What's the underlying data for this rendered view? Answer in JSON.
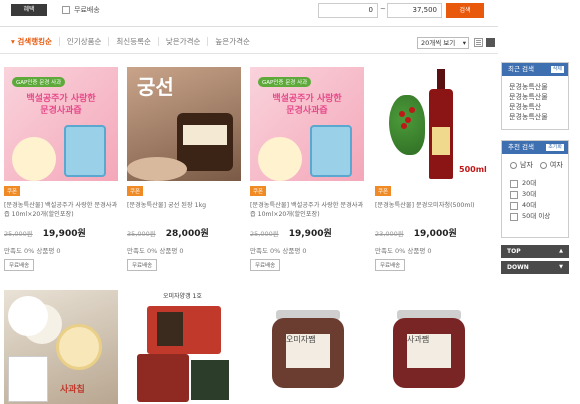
{
  "filter": {
    "benefit_label": "혜택",
    "free_shipping_label": "무료배송",
    "price_min": "0",
    "price_max": "37,500",
    "search_label": "검색"
  },
  "sort": {
    "items": [
      "검색랭킹순",
      "인기상품순",
      "최신등록순",
      "낮은가격순",
      "높은가격순"
    ],
    "active": "검색랭킹순",
    "per_page": "20개씩 보기"
  },
  "products": [
    {
      "badge": "GAP인증 문경 사과",
      "img_text": "백설공주가 사랑한\n문경사과즙",
      "tag": "쿠폰",
      "name": "[문경농특산물] 백설공주가 사랑한 문경사과즙 10ml×20개(할인포장)",
      "old_price": "25,000원",
      "price": "19,900원",
      "satisfaction": "만족도 0%",
      "reviews": "상품평 0",
      "ship": "무료배송"
    },
    {
      "img_text": "궁선",
      "tag": "쿠폰",
      "name": "[문경농특산물] 궁선 된장 1kg",
      "old_price": "35,000원",
      "price": "28,000원",
      "satisfaction": "만족도 0%",
      "reviews": "상품평 0",
      "ship": "무료배송"
    },
    {
      "badge": "GAP인증 문경 사과",
      "img_text": "백설공주가 사랑한\n문경사과즙",
      "tag": "쿠폰",
      "name": "[문경농특산물] 백설공주가 사랑한 문경사과즙 10ml×20개(할인포장)",
      "old_price": "25,000원",
      "price": "19,900원",
      "satisfaction": "만족도 0%",
      "reviews": "상품평 0",
      "ship": "무료배송"
    },
    {
      "img_text": "500ml",
      "tag": "쿠폰",
      "name": "[문경농특산물] 문경오미자청(500ml)",
      "old_price": "23,000원",
      "price": "19,000원",
      "satisfaction": "만족도 0%",
      "reviews": "상품평 0",
      "ship": "무료배송"
    }
  ],
  "row2": [
    {
      "img_text": "사과칩"
    },
    {
      "img_text": "오미자양갱 1호"
    },
    {
      "img_text": "오미자쨈"
    },
    {
      "img_text": "사과쨈"
    }
  ],
  "sidebar": {
    "recent_title": "최근 검색",
    "recent_mini": "삭제",
    "recent_items": [
      "문경농특산물",
      "문경농특산물",
      "문경농특산",
      "문경농특산물"
    ],
    "recommend_title": "추천 검색",
    "recommend_mini": "초기화",
    "gender": [
      "남자",
      "여자"
    ],
    "ages": [
      "20대",
      "30대",
      "40대",
      "50대 이상"
    ],
    "top_label": "TOP",
    "down_label": "DOWN"
  },
  "colors": {
    "accent": "#e8590c",
    "sidebar_blue": "#3e6fb0"
  }
}
